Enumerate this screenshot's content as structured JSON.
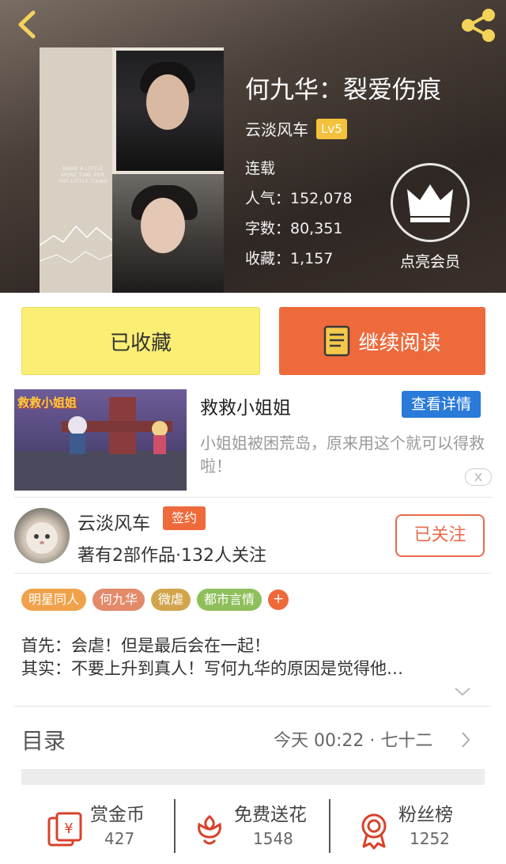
{
  "book": {
    "title": "何九华：裂爱伤痕",
    "author": "云淡风车",
    "level": "Lv5",
    "status": "连载",
    "popularity": "人气：152,078",
    "words": "字数：80,351",
    "favorites": "收藏：1,157",
    "cover_text": "MAKE A LITTLE MORE TIME FOR THE LITTLE THING"
  },
  "vip": {
    "label": "点亮会员"
  },
  "actions": {
    "collected_label": "已收藏",
    "continue_label": "继续阅读"
  },
  "ad": {
    "title": "救救小姐姐",
    "detail_label": "查看详情",
    "description": "小姐姐被困荒岛，原来用这个就可以得救啦！",
    "image_text": "救救小姐姐"
  },
  "author_card": {
    "name": "云淡风车",
    "badge": "签约",
    "stats": "著有2部作品·132人关注",
    "follow_label": "已关注"
  },
  "tags": [
    {
      "label": "明星同人",
      "color": "#f0a24a"
    },
    {
      "label": "何九华",
      "color": "#e38a6a"
    },
    {
      "label": "微虐",
      "color": "#d2a54d"
    },
    {
      "label": "都市言情",
      "color": "#8fbf5a"
    }
  ],
  "tag_more": "+",
  "synopsis": {
    "line1": "首先：会虐！但是最后会在一起！",
    "line2": "其实：不要上升到真人！写何九华的原因是觉得他…"
  },
  "toc": {
    "label": "目录",
    "latest": "今天 00:22 · 七十二"
  },
  "bottom_bar": [
    {
      "label": "赏金币",
      "count": "427",
      "icon": "reward-coin-icon"
    },
    {
      "label": "免费送花",
      "count": "1548",
      "icon": "flower-icon"
    },
    {
      "label": "粉丝榜",
      "count": "1252",
      "icon": "fan-ranking-icon"
    }
  ],
  "colors": {
    "accent": "#ee6a3b",
    "collected_bg": "#faef74",
    "ad_button": "#2a7ad9",
    "icon_red": "#d9412b"
  }
}
